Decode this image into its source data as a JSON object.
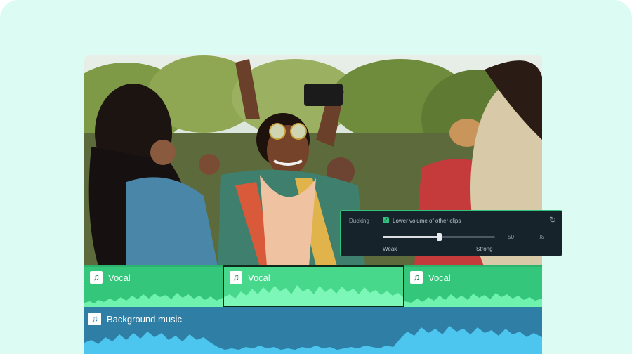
{
  "ducking": {
    "label": "Ducking",
    "checkbox_label": "Lower volume of other clips",
    "checked": true,
    "value": "50",
    "value_fraction": 0.5,
    "unit": "%",
    "min_label": "Weak",
    "max_label": "Strong",
    "reset_icon": "reset-icon"
  },
  "tracks": {
    "vocal_clips": [
      {
        "label": "Vocal",
        "icon": "music-note-icon",
        "selected": false
      },
      {
        "label": "Vocal",
        "icon": "music-note-icon",
        "selected": true
      },
      {
        "label": "Vocal",
        "icon": "music-note-icon",
        "selected": false
      }
    ],
    "background": {
      "label": "Background music",
      "icon": "music-note-icon"
    }
  },
  "colors": {
    "canvas": "#dcfbf3",
    "vocal_track": "#34c77b",
    "vocal_wave": "#6ff2ad",
    "background_track": "#2e7ea6",
    "background_wave": "#4cc6ee",
    "panel": "#17232b",
    "panel_border": "#2ec27e"
  }
}
